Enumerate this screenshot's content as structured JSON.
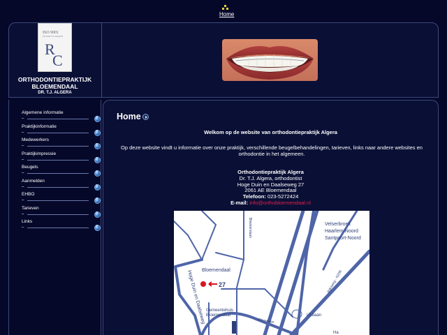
{
  "topnav": {
    "home_label": "Home"
  },
  "logo": {
    "iso_text": "ISO 9001",
    "iso_sub": "GECERTIFICEERD",
    "letters": "RC"
  },
  "practice": {
    "name_line1": "ORTHODONTIEPRAKTIJK",
    "name_line2": "BLOEMENDAAL",
    "doctor": "DR. T.J. ALGERA"
  },
  "sidebar": {
    "items": [
      {
        "label": "Algemene informatie",
        "dash": "–"
      },
      {
        "label": "Praktijkinformatie",
        "dash": "–"
      },
      {
        "label": "Medewerkers",
        "dash": "–"
      },
      {
        "label": "Praktijkimpressie",
        "dash": "–"
      },
      {
        "label": "Beugels",
        "dash": "–"
      },
      {
        "label": "Aanmelden",
        "dash": "–"
      },
      {
        "label": "EHBO",
        "dash": "–"
      },
      {
        "label": "Tarieven",
        "dash": "–"
      },
      {
        "label": "Links",
        "dash": "–"
      }
    ]
  },
  "main": {
    "title": "Home",
    "welcome": "Welkom op de website van orthodontiepraktijk Algera",
    "intro": "Op deze website vindt u informatie over onze praktijk, verschillende beugelbehandelingen, tarieven, links naar andere websites en orthodontie in het algemeen.",
    "address": {
      "name": "Orthodontiepraktijk Algera",
      "doctor": "Dr. T.J. Algera, orthodontist",
      "street": "Hoge Duin en Daalseweg 27",
      "city": "2061 AE Bloemendaal",
      "phone_label": "Telefoon:",
      "phone": "023-5272424",
      "email_label": "E-mail:",
      "email": "info@orthobloemendaal.nl"
    }
  },
  "map": {
    "labels": {
      "velserbroek": "Velserbroek",
      "haarlem_noord": "Haarlem-Noord",
      "santpoort_noord": "Santpoort-Noord",
      "bloemendaal": "Bloemendaal",
      "number": "27",
      "gemeentehuis": "Gemeentehuis",
      "gemeentehuis2": "Bloemendaal",
      "hoge_duin": "Hoge Duin en Daalseweg",
      "bleekerslaan": "Bleekerslaan",
      "rijksweg": "Rijksweg - N208",
      "ijsbaan": "IJsbaan",
      "kleverlaan": "Kleverlaan",
      "extra": "Ha"
    }
  },
  "colors": {
    "background": "#06082a",
    "panel": "#0a0f35",
    "border": "#3c4a7c",
    "link": "#e0204a",
    "map_road": "#4f65a8"
  }
}
